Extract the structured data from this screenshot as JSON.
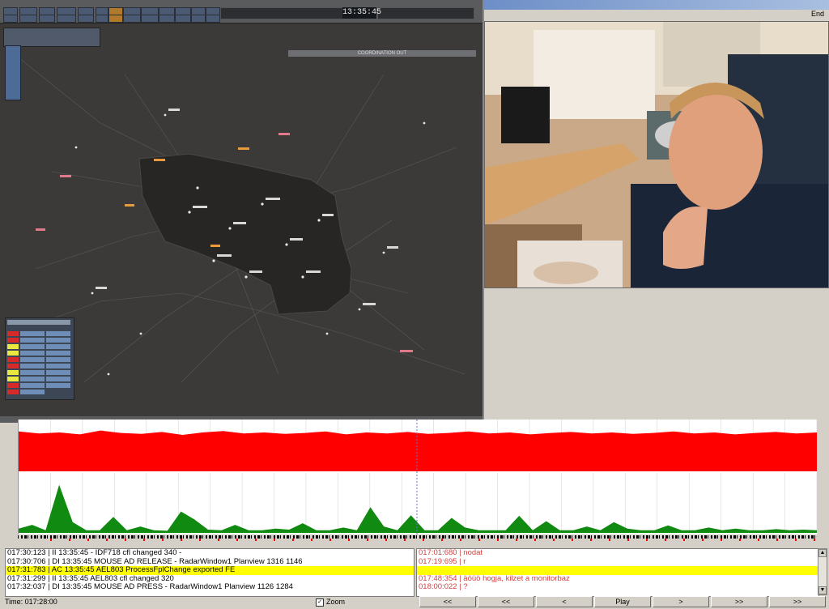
{
  "window": {
    "end_label": "End"
  },
  "radar": {
    "clock": "13:35:45",
    "coordination_label": "COORDINATION OUT"
  },
  "log": {
    "lines": [
      {
        "text": "017:30:123 | II 13:35:45 - IDF718 cfl changed 340 -",
        "highlight": false
      },
      {
        "text": "017:30:706 | DI 13:35:45 MOUSE AD RELEASE - RadarWindow1 Planview 1316 1146",
        "highlight": false
      },
      {
        "text": "017:31:783 | AC 13:35:45   AEL803 ProcessFplChange exported FE",
        "highlight": true
      },
      {
        "text": "017:31:299 | II 13:35:45   AEL803 cfl changed 320",
        "highlight": false
      },
      {
        "text": "017:32:037 | DI 13:35:45 MOUSE AD PRESS - RadarWindow1 Planview 1126 1284",
        "highlight": false
      }
    ],
    "notes": [
      {
        "text": "017:01:680 |  nodat",
        "highlight": false
      },
      {
        "text": "017:19:695 |  r",
        "highlight": false
      },
      {
        "text": "",
        "highlight": true
      },
      {
        "text": "017:48:354 |  äöüö hogja, kilzet a monitorbaz",
        "highlight": false
      },
      {
        "text": "018:00:022 |  ?",
        "highlight": false
      }
    ]
  },
  "status": {
    "time": "Time: 017:28:00"
  },
  "zoom": {
    "label": "Zoom",
    "checked": true
  },
  "controls": [
    {
      "name": "rewind-start-button",
      "label": "<<"
    },
    {
      "name": "fast-rewind-button",
      "label": "<<"
    },
    {
      "name": "step-back-button",
      "label": "<"
    },
    {
      "name": "play-button",
      "label": "Play"
    },
    {
      "name": "step-forward-button",
      "label": ">"
    },
    {
      "name": "fast-forward-button",
      "label": ">>"
    },
    {
      "name": "forward-end-button",
      "label": ">>"
    }
  ],
  "colors": {
    "accent_red": "#ff0000",
    "accent_green": "#108a10",
    "highlight": "#ffff00",
    "radar_bg": "#3b3a39",
    "sector": "#272624"
  },
  "chart_data": [
    {
      "type": "area",
      "title": "",
      "series": [
        {
          "values": [
            0.82,
            0.78,
            0.8,
            0.76,
            0.84,
            0.79,
            0.77,
            0.81,
            0.75,
            0.8,
            0.83,
            0.78,
            0.8,
            0.77,
            0.79,
            0.82,
            0.76,
            0.8,
            0.78,
            0.81,
            0.77,
            0.79,
            0.82,
            0.78,
            0.8,
            0.76,
            0.79,
            0.81,
            0.78,
            0.8,
            0.77,
            0.79,
            0.82,
            0.78,
            0.8,
            0.76,
            0.79,
            0.81,
            0.78,
            0.8
          ]
        }
      ],
      "ylim": [
        0,
        1
      ]
    },
    {
      "type": "area",
      "title": "",
      "series": [
        {
          "values": [
            0.08,
            0.15,
            0.05,
            0.9,
            0.2,
            0.05,
            0.05,
            0.3,
            0.05,
            0.12,
            0.05,
            0.04,
            0.4,
            0.25,
            0.06,
            0.05,
            0.15,
            0.05,
            0.05,
            0.08,
            0.06,
            0.18,
            0.05,
            0.05,
            0.1,
            0.05,
            0.48,
            0.12,
            0.05,
            0.33,
            0.05,
            0.05,
            0.28,
            0.1,
            0.05,
            0.05,
            0.05,
            0.32,
            0.05,
            0.22,
            0.05,
            0.05,
            0.12,
            0.05,
            0.2,
            0.08,
            0.05,
            0.05,
            0.14,
            0.05,
            0.05,
            0.1,
            0.05,
            0.08,
            0.05,
            0.05,
            0.07,
            0.05,
            0.06,
            0.05
          ]
        }
      ],
      "ylim": [
        0,
        1
      ]
    }
  ]
}
